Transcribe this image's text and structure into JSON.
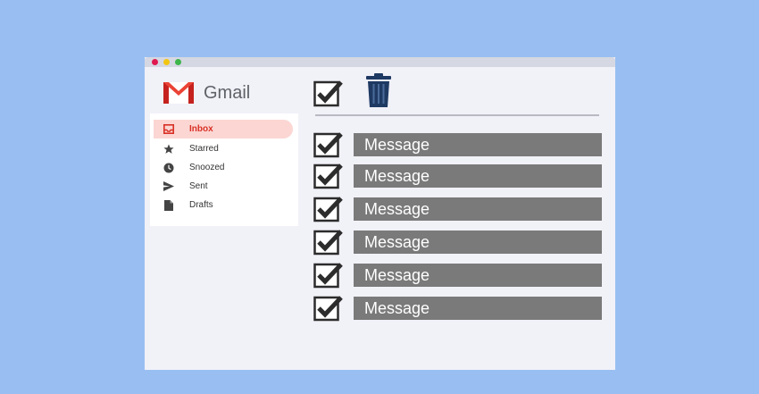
{
  "app": {
    "name": "Gmail",
    "colors": {
      "background": "#99bff2",
      "window": "#f1f1f8",
      "accent": "#d93025",
      "active_nav_bg": "#fbd6d3",
      "message_bar": "#7a7a7a"
    }
  },
  "sidebar": {
    "items": [
      {
        "label": "Inbox",
        "icon": "inbox-icon",
        "active": true
      },
      {
        "label": "Starred",
        "icon": "star-icon",
        "active": false
      },
      {
        "label": "Snoozed",
        "icon": "clock-icon",
        "active": false
      },
      {
        "label": "Sent",
        "icon": "send-icon",
        "active": false
      },
      {
        "label": "Drafts",
        "icon": "draft-icon",
        "active": false
      }
    ]
  },
  "toolbar": {
    "select_all_checked": true,
    "delete_icon": "trash-icon"
  },
  "messages": [
    {
      "label": "Message",
      "checked": true
    },
    {
      "label": "Message",
      "checked": true
    },
    {
      "label": "Message",
      "checked": true
    },
    {
      "label": "Message",
      "checked": true
    },
    {
      "label": "Message",
      "checked": true
    },
    {
      "label": "Message",
      "checked": true
    }
  ]
}
